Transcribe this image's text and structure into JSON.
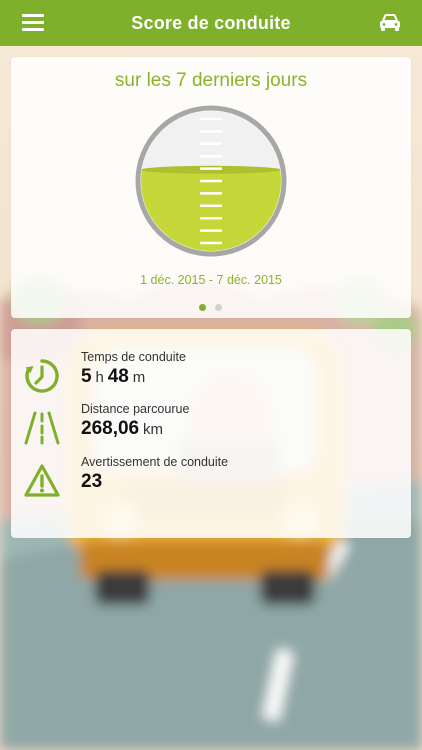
{
  "header": {
    "title": "Score de conduite",
    "menu_icon": "menu-icon",
    "car_icon": "car-icon",
    "background_color": "#7fb02b"
  },
  "summary_card": {
    "period_title": "sur les 7 derniers jours",
    "date_range": "1 déc. 2015 - 7 déc. 2015",
    "gauge_fill": 0.58,
    "accent_color": "#8ab52a",
    "gauge_fill_color": "#c6d73a",
    "pagination": {
      "count": 2,
      "active_index": 0
    }
  },
  "stats": {
    "driving_time": {
      "label": "Temps de conduite",
      "hours": "5",
      "hours_unit": "h",
      "minutes": "48",
      "minutes_unit": "m",
      "icon": "clock-icon"
    },
    "distance": {
      "label": "Distance parcourue",
      "value": "268,06",
      "unit": "km",
      "icon": "road-icon"
    },
    "warnings": {
      "label": "Avertissement de conduite",
      "value": "23",
      "icon": "warning-icon"
    }
  }
}
